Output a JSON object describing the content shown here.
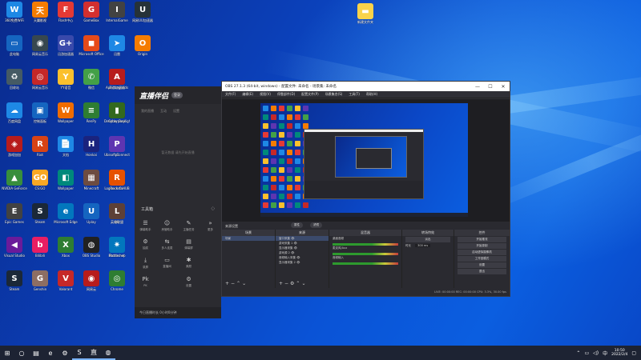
{
  "desktop": {
    "icons": [
      {
        "label": "360免费WiFi",
        "glyph": "W",
        "color": "#1e88e5"
      },
      {
        "label": "天翼影视",
        "glyph": "天",
        "color": "#f57c00"
      },
      {
        "label": "Flash中心",
        "glyph": "F",
        "color": "#e53935"
      },
      {
        "label": "GameBox",
        "glyph": "G",
        "color": "#d32f2f"
      },
      {
        "label": "InternalGame",
        "glyph": "I",
        "color": "#424242"
      },
      {
        "label": "网易UU加速器",
        "glyph": "U",
        "color": "#263238"
      },
      {
        "label": "此电脑",
        "glyph": "▭",
        "color": "#1565c0"
      },
      {
        "label": "网易云音乐",
        "glyph": "◉",
        "color": "#37474f"
      },
      {
        "label": "迅游加速器",
        "glyph": "G+",
        "color": "#3949ab"
      },
      {
        "label": "Microsoft Office",
        "glyph": "◼",
        "color": "#e64a19"
      },
      {
        "label": "迅雷",
        "glyph": "➤",
        "color": "#1e88e5"
      },
      {
        "label": "Origin",
        "glyph": "O",
        "color": "#f57c00"
      },
      {
        "label": "回收站",
        "glyph": "♻",
        "color": "#455a64"
      },
      {
        "label": "网易云音乐",
        "glyph": "◎",
        "color": "#c62828"
      },
      {
        "label": "YY语音",
        "glyph": "Y",
        "color": "#fbc02d"
      },
      {
        "label": "微信",
        "glyph": "✆",
        "color": "#43a047"
      },
      {
        "label": "奇游加速器",
        "glyph": "奇",
        "color": "#c62828"
      },
      {
        "label": "Apex Legends",
        "glyph": "A",
        "color": "#b71c1c"
      },
      {
        "label": "百度网盘",
        "glyph": "☁",
        "color": "#1e88e5"
      },
      {
        "label": "控制面板",
        "glyph": "▣",
        "color": "#1565c0"
      },
      {
        "label": "Wallpaper",
        "glyph": "W",
        "color": "#ef6c00"
      },
      {
        "label": "RenPy",
        "glyph": "≡",
        "color": "#2e7d32"
      },
      {
        "label": "Dead by Daylight",
        "glyph": "2",
        "color": "#111111"
      },
      {
        "label": "Cyberpunk",
        "glyph": "▮",
        "color": "#33691e"
      },
      {
        "label": "游戏加加",
        "glyph": "◈",
        "color": "#b71c1c"
      },
      {
        "label": "Riot",
        "glyph": "R",
        "color": "#d84315"
      },
      {
        "label": "文档",
        "glyph": "📄",
        "color": "#1e88e5"
      },
      {
        "label": "Honkai",
        "glyph": "H",
        "color": "#1a237e"
      },
      {
        "label": "Ubisoft Connect",
        "glyph": "✦",
        "color": "#1976d2"
      },
      {
        "label": "ps",
        "glyph": "P",
        "color": "#5e35b1"
      },
      {
        "label": "NVIDIA GeForce",
        "glyph": "▲",
        "color": "#388e3c"
      },
      {
        "label": "CS:GO",
        "glyph": "GO",
        "color": "#f9a825"
      },
      {
        "label": "Wallpaper",
        "glyph": "◧",
        "color": "#00897b"
      },
      {
        "label": "Minecraft",
        "glyph": "▦",
        "color": "#6d4c41"
      },
      {
        "label": "Logitech G HUB",
        "glyph": "G",
        "color": "#212121"
      },
      {
        "label": "Rockstar",
        "glyph": "R",
        "color": "#e65100"
      },
      {
        "label": "Epic Games",
        "glyph": "E",
        "color": "#424242"
      },
      {
        "label": "Steam",
        "glyph": "S",
        "color": "#1b2838"
      },
      {
        "label": "Microsoft Edge",
        "glyph": "e",
        "color": "#0277bd"
      },
      {
        "label": "Uplay",
        "glyph": "U",
        "color": "#1565c0"
      },
      {
        "label": "QQ",
        "glyph": "Q",
        "color": "#0288d1"
      },
      {
        "label": "英雄联盟",
        "glyph": "L",
        "color": "#5d4037"
      },
      {
        "label": "Visual Studio",
        "glyph": "◀",
        "color": "#6a1b9a"
      },
      {
        "label": "Bilibili",
        "glyph": "b",
        "color": "#e91e63"
      },
      {
        "label": "Xbox",
        "glyph": "X",
        "color": "#2e7d32"
      },
      {
        "label": "OBS Studio",
        "glyph": "◍",
        "color": "#212121"
      },
      {
        "label": "Photoshop",
        "glyph": "Ps",
        "color": "#0d47a1"
      },
      {
        "label": "Battle.net",
        "glyph": "✷",
        "color": "#0277bd"
      },
      {
        "label": "Steam",
        "glyph": "S",
        "color": "#1b2838"
      },
      {
        "label": "Genshin",
        "glyph": "G",
        "color": "#8d6e63"
      },
      {
        "label": "Valorant",
        "glyph": "V",
        "color": "#c62828"
      },
      {
        "label": "网易云",
        "glyph": "◉",
        "color": "#b71c1c"
      },
      {
        "label": "Chrome",
        "glyph": "◎",
        "color": "#2e7d32"
      },
      {
        "label": "新建文件夹",
        "glyph": "▬",
        "color": "#f9d34a"
      }
    ]
  },
  "app": {
    "logo": "直播伴侣",
    "badge": "登录",
    "tabs": [
      "我的直播",
      "互动",
      "设置"
    ],
    "empty_text": "暂无数据  请先开始直播",
    "tools_title": "工具箱",
    "tools": [
      {
        "label": "弹幕助手",
        "glyph": "☰"
      },
      {
        "label": "房管助手",
        "glyph": "☺"
      },
      {
        "label": "主播任务",
        "glyph": "✎"
      },
      {
        "label": "更多",
        "glyph": "»"
      },
      {
        "label": "抽奖",
        "glyph": "⚙"
      },
      {
        "label": "多人连麦",
        "glyph": "⇆"
      },
      {
        "label": "弹幕屏",
        "glyph": "▤"
      },
      {
        "label": "",
        "glyph": ""
      },
      {
        "label": "录屏",
        "glyph": "⤓"
      },
      {
        "label": "直播间",
        "glyph": "▭"
      },
      {
        "label": "美颜",
        "glyph": "✱"
      },
      {
        "label": "",
        "glyph": ""
      },
      {
        "label": "PK",
        "glyph": "Pk"
      },
      {
        "label": "",
        "glyph": ""
      },
      {
        "label": "设置",
        "glyph": "⚙"
      },
      {
        "label": "",
        "glyph": ""
      }
    ],
    "status": "今日直播时长 0小时0分钟"
  },
  "obs": {
    "title": "OBS 27.1.3 (64-bit, windows) - 配置文件: 未命名 - 场景集: 未命名",
    "menu": [
      "文件(F)",
      "编辑(E)",
      "视图(V)",
      "停靠部件(D)",
      "配置文件(P)",
      "场景集合(S)",
      "工具(T)",
      "帮助(H)"
    ],
    "scene_label": "来源设置",
    "pill_properties": "属性",
    "pill_filters": "滤镜",
    "docks": {
      "scenes": {
        "title": "场景",
        "items": [
          "场景"
        ]
      },
      "sources": {
        "title": "来源",
        "items": [
          "窗口采集",
          "游戏采集 1",
          "显示器采集",
          "游戏源 2",
          "音频输入采集",
          "显示器采集 2"
        ]
      },
      "mixer": {
        "title": "混音器",
        "items": [
          "桌面音频",
          "麦克风/Aux",
          "音频输入"
        ]
      },
      "transitions": {
        "title": "转场特效",
        "type": "淡出",
        "duration_label": "时长",
        "duration_value": "300 ms"
      },
      "controls": {
        "title": "控件",
        "buttons": [
          "开始推流",
          "开始录制",
          "启动虚拟摄像机",
          "工作室模式",
          "设置",
          "退出"
        ]
      }
    },
    "status": "LIVE: 00:00:00   REC: 00:00:00   CPU: 3.3%, 30.00 fps"
  },
  "taskbar": {
    "items": [
      {
        "name": "start",
        "glyph": "⊞"
      },
      {
        "name": "search",
        "glyph": "○"
      },
      {
        "name": "task-view",
        "glyph": "▤"
      },
      {
        "name": "edge",
        "glyph": "e"
      },
      {
        "name": "settings",
        "glyph": "⚙"
      },
      {
        "name": "steam",
        "glyph": "S"
      },
      {
        "name": "live-app",
        "glyph": "直"
      },
      {
        "name": "obs",
        "glyph": "◍"
      }
    ],
    "time": "10:50",
    "date": "2022/2/4"
  }
}
